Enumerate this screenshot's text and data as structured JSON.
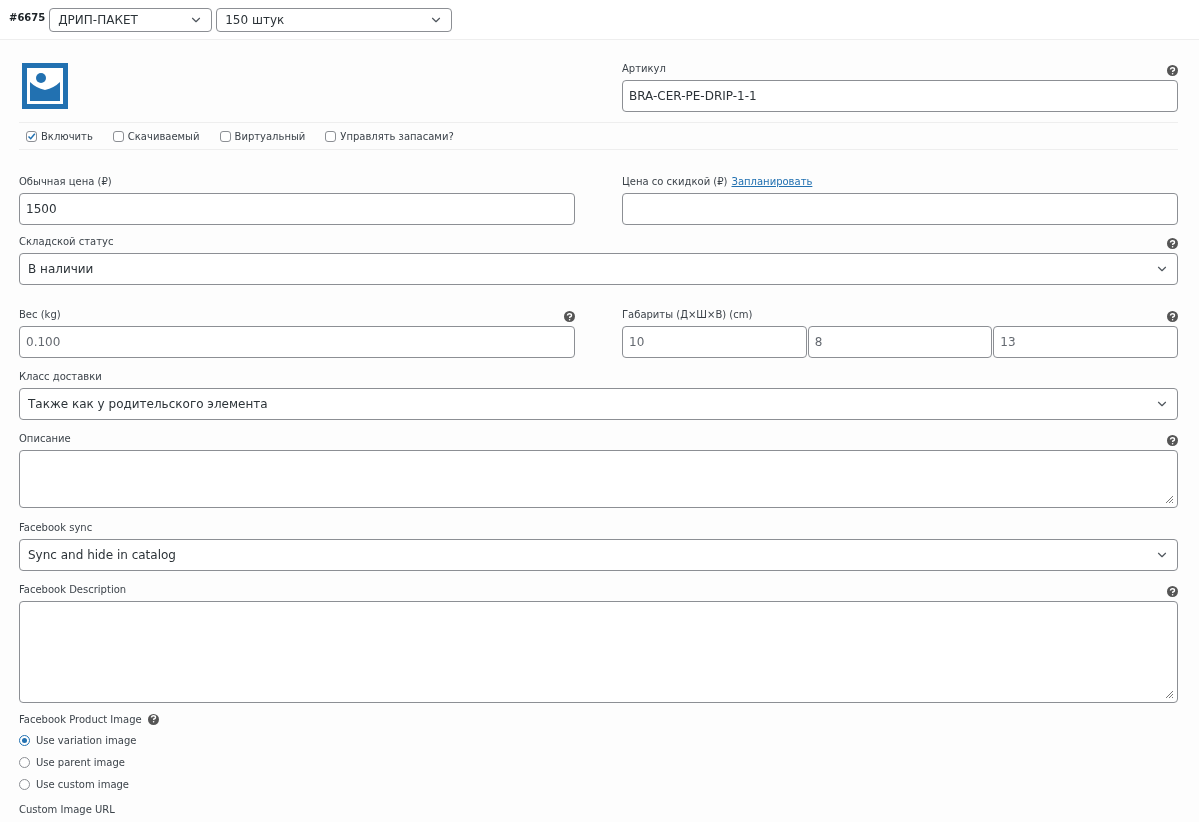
{
  "header": {
    "variation_id": "#6675",
    "selects": [
      {
        "value": "ДРИП-ПАКЕТ"
      },
      {
        "value": "150 штук"
      }
    ]
  },
  "sku": {
    "label": "Артикул",
    "value": "BRA-CER-PE-DRIP-1-1",
    "help": true
  },
  "options": [
    {
      "label": "Включить",
      "checked": true
    },
    {
      "label": "Скачиваемый",
      "checked": false
    },
    {
      "label": "Виртуальный",
      "checked": false
    },
    {
      "label": "Управлять запасами?",
      "checked": false
    }
  ],
  "regular_price": {
    "label": "Обычная цена (₽)",
    "value": "1500"
  },
  "sale_price": {
    "label": "Цена со скидкой (₽)",
    "link": "Запланировать"
  },
  "stock_status": {
    "label": "Складской статус",
    "value": "В наличии",
    "help": true
  },
  "weight": {
    "label": "Вес (kg)",
    "placeholder": "0.100",
    "help": true
  },
  "dimensions": {
    "label": "Габариты (Д×Ш×В) (cm)",
    "help": true,
    "fields": [
      {
        "placeholder": "10"
      },
      {
        "placeholder": "8"
      },
      {
        "placeholder": "13"
      }
    ]
  },
  "shipping_class": {
    "label": "Класс доставки",
    "value": "Также как у родительского элемента"
  },
  "description": {
    "label": "Описание",
    "help": true
  },
  "facebook_sync": {
    "label": "Facebook sync",
    "value": "Sync and hide in catalog"
  },
  "facebook_description": {
    "label": "Facebook Description",
    "help": true
  },
  "facebook_image": {
    "label": "Facebook Product Image",
    "help": true,
    "choices": [
      {
        "label": "Use variation image",
        "selected": true
      },
      {
        "label": "Use parent image",
        "selected": false
      },
      {
        "label": "Use custom image",
        "selected": false
      }
    ]
  },
  "custom_image_url": {
    "label": "Custom Image URL"
  }
}
